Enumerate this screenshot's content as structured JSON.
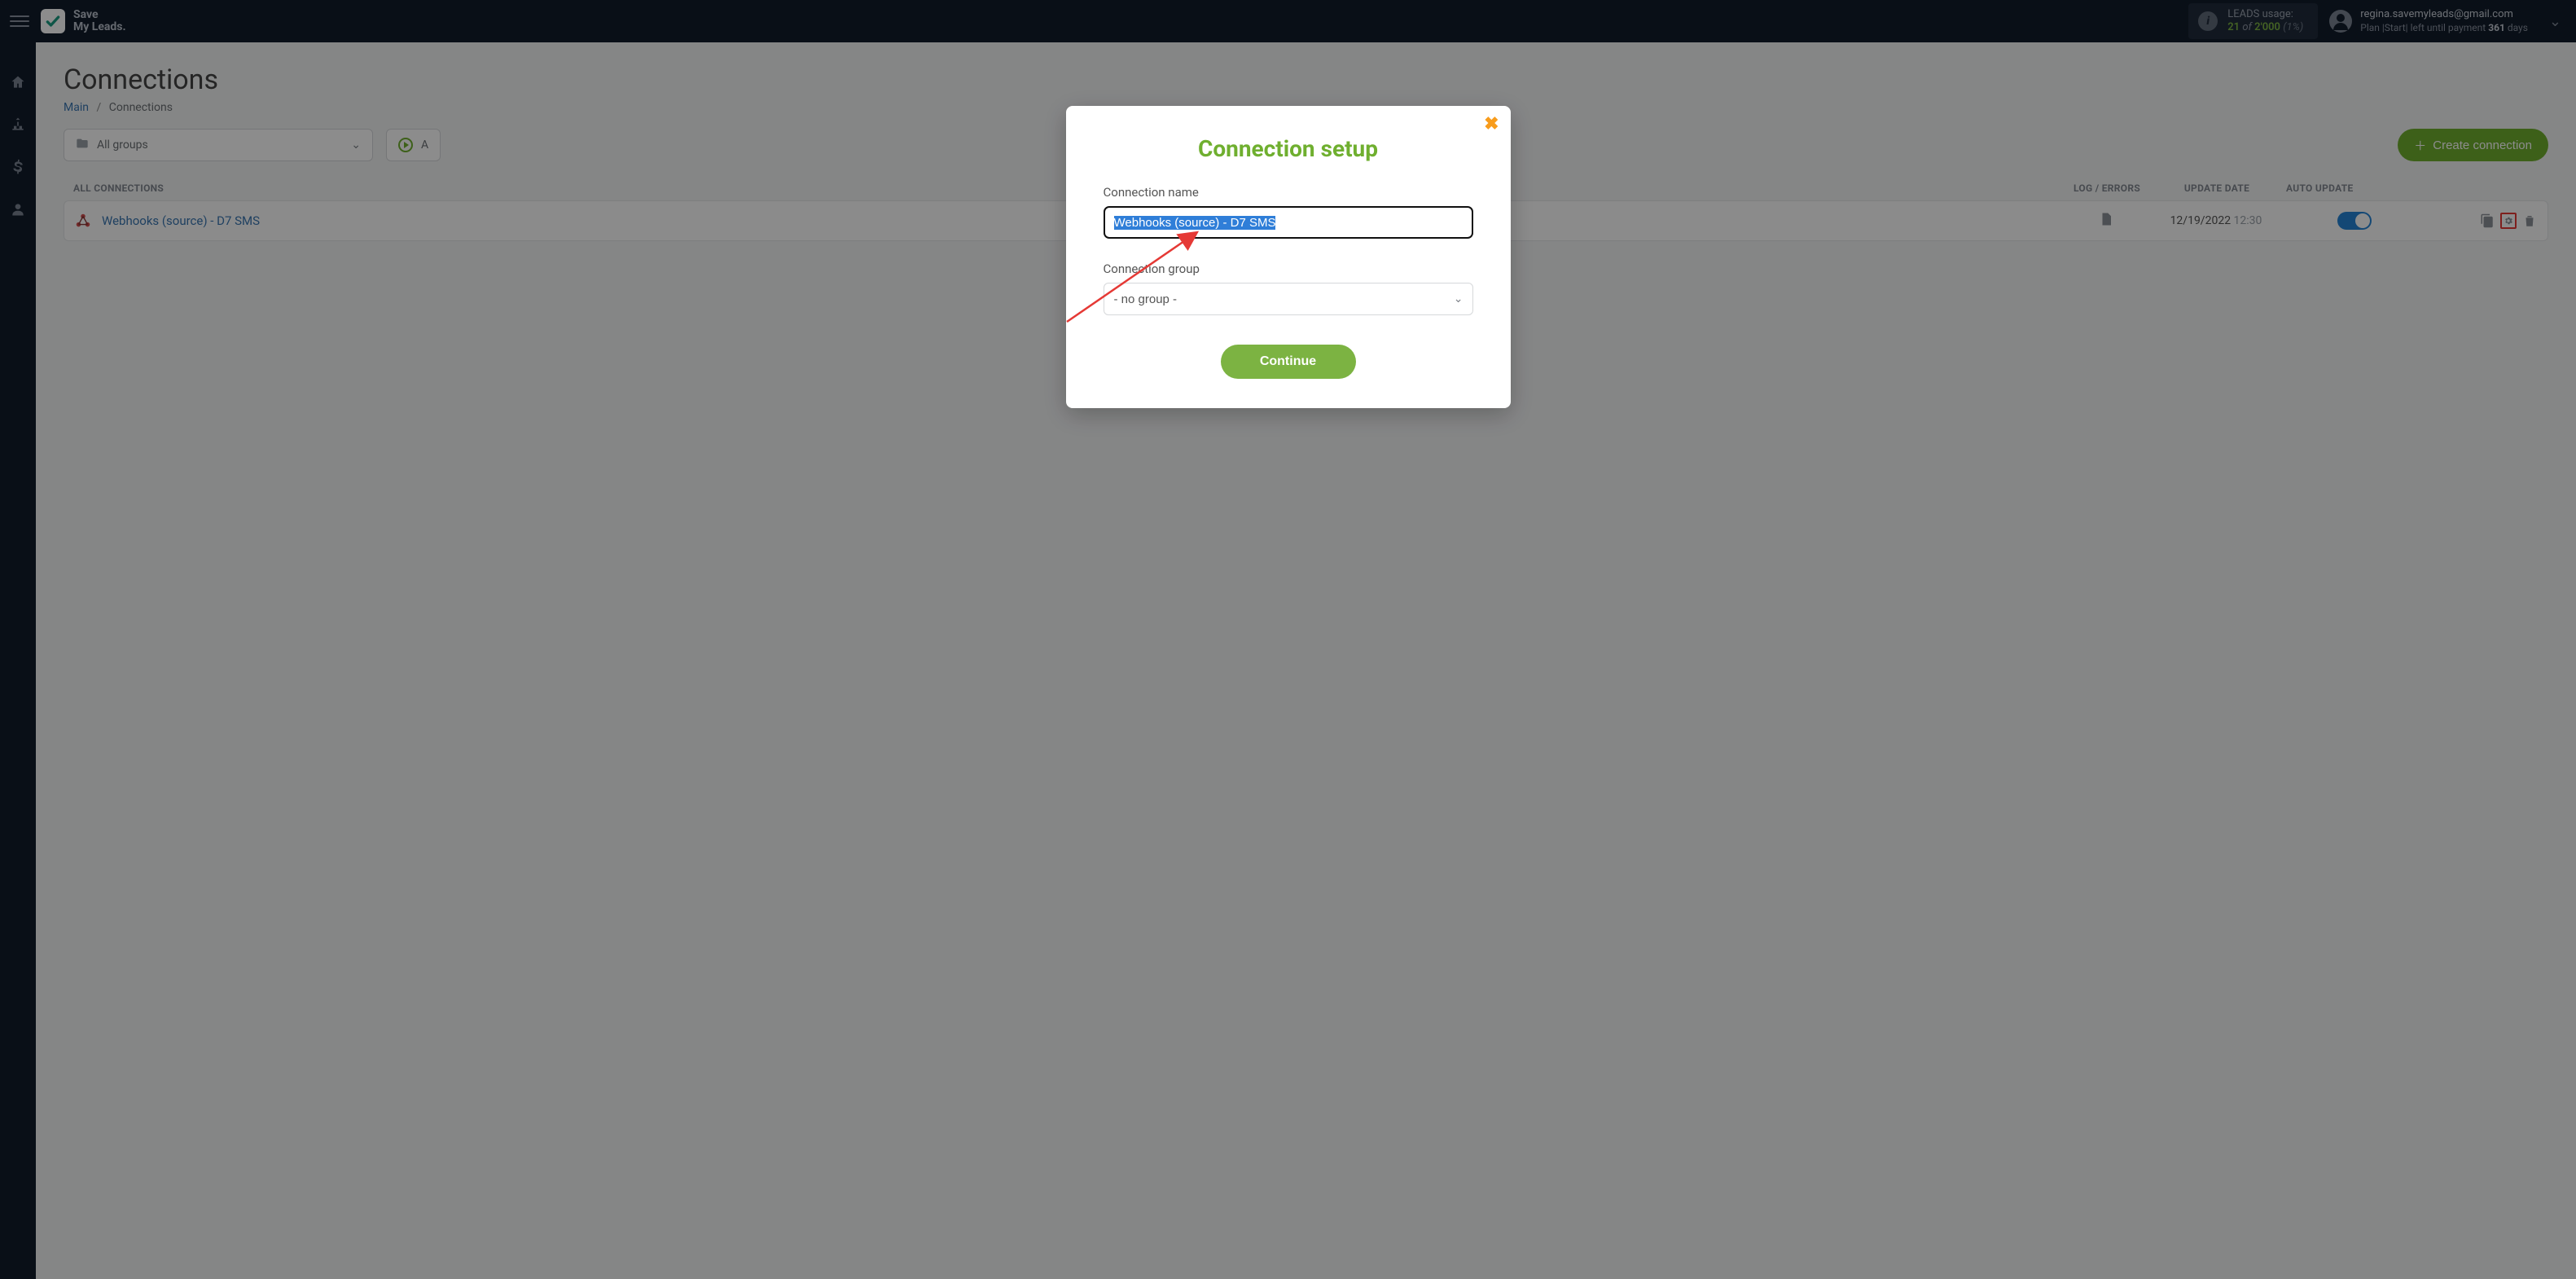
{
  "brand": {
    "line1": "Save",
    "line2": "My Leads."
  },
  "usage": {
    "label": "LEADS usage:",
    "used": "21",
    "of_word": "of",
    "total": "2'000",
    "percent": "(1%)"
  },
  "account": {
    "email": "regina.savemyleads@gmail.com",
    "plan_prefix": "Plan |Start| left until payment",
    "days_count": "361",
    "days_word": "days"
  },
  "page": {
    "title": "Connections",
    "breadcrumb_main": "Main",
    "breadcrumb_current": "Connections"
  },
  "filters": {
    "groups_label": "All groups",
    "status_partial": "A"
  },
  "actions": {
    "create_label": "Create connection"
  },
  "table": {
    "col_all": "ALL CONNECTIONS",
    "col_log": "LOG / ERRORS",
    "col_update": "UPDATE DATE",
    "col_auto": "AUTO UPDATE",
    "rows": [
      {
        "name": "Webhooks (source) - D7 SMS",
        "date": "12/19/2022",
        "time": "12:30"
      }
    ]
  },
  "modal": {
    "title": "Connection setup",
    "name_label": "Connection name",
    "name_value": "Webhooks (source) - D7 SMS",
    "group_label": "Connection group",
    "group_value": "- no group -",
    "continue": "Continue"
  }
}
